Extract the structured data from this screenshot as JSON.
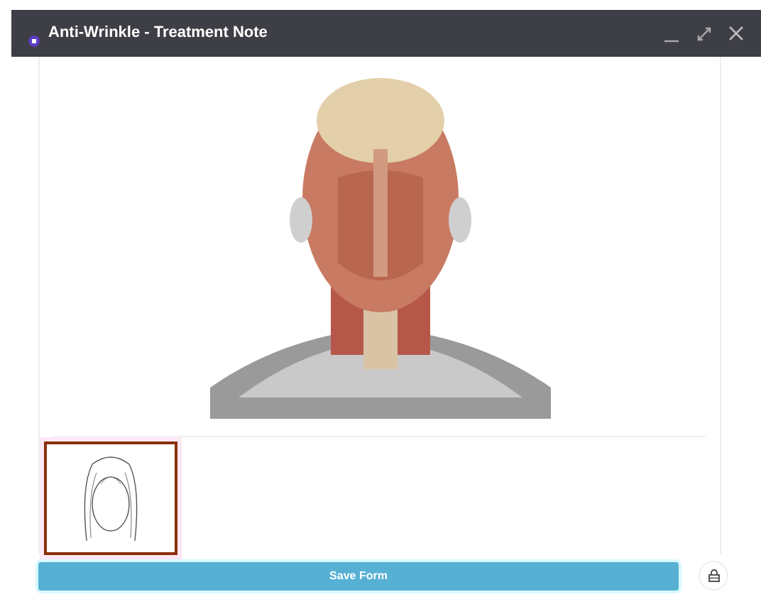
{
  "window": {
    "title": "Anti-Wrinkle - Treatment Note"
  },
  "diagram": {
    "kind": "picture"
  },
  "thumbnails": [
    {
      "kind": "picture",
      "selected": true
    }
  ],
  "footer": {
    "save_button": "Save Form"
  }
}
